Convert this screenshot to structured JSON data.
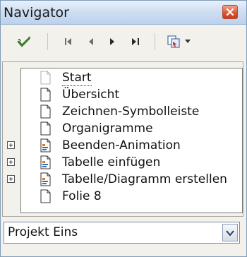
{
  "window": {
    "title": "Navigator"
  },
  "toolbar": {
    "buttons": [
      {
        "name": "apply-icon"
      },
      {
        "name": "first-slide-icon"
      },
      {
        "name": "previous-slide-icon"
      },
      {
        "name": "next-slide-icon"
      },
      {
        "name": "last-slide-icon"
      },
      {
        "name": "drag-mode-icon"
      }
    ]
  },
  "tree": {
    "items": [
      {
        "label": "Start",
        "expandable": false,
        "selected": true
      },
      {
        "label": "Übersicht",
        "expandable": false
      },
      {
        "label": "Zeichnen-Symbolleiste",
        "expandable": false
      },
      {
        "label": "Organigramme",
        "expandable": false
      },
      {
        "label": "Beenden-Animation",
        "expandable": true
      },
      {
        "label": "Tabelle einfügen",
        "expandable": true
      },
      {
        "label": "Tabelle/Diagramm erstellen",
        "expandable": true
      },
      {
        "label": "Folie 8",
        "expandable": false
      }
    ]
  },
  "document_select": {
    "value": "Projekt Eins"
  },
  "colors": {
    "accent_green": "#3a8a2a",
    "titlebar": "#cfdff2",
    "close": "#d9532f"
  }
}
